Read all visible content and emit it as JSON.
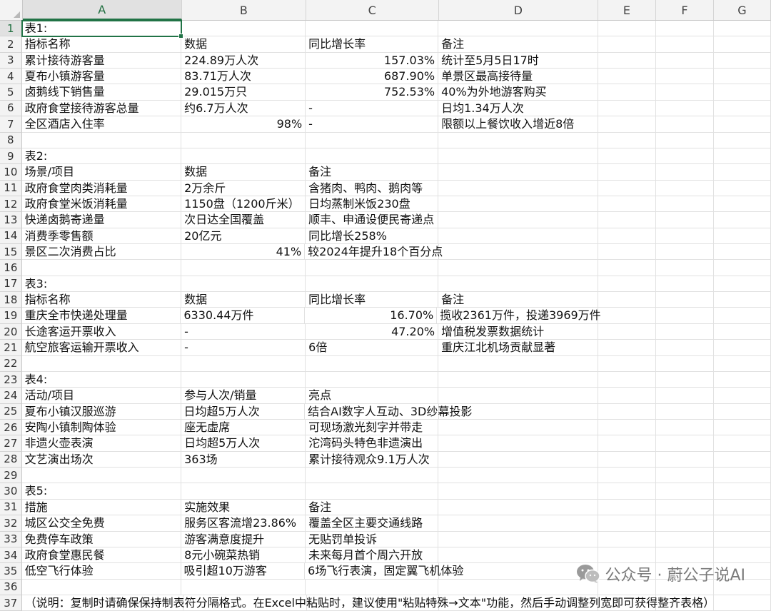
{
  "columns": [
    "A",
    "B",
    "C",
    "D",
    "E",
    "F",
    "G"
  ],
  "rows": [
    {
      "n": "1",
      "a": "表1:",
      "b": "",
      "c": "",
      "d": ""
    },
    {
      "n": "2",
      "a": "指标名称",
      "b": "数据",
      "c": "同比增长率",
      "d": "备注"
    },
    {
      "n": "3",
      "a": "累计接待游客量",
      "b": "224.89万人次",
      "c": "157.03%",
      "d": "统计至5月5日17时",
      "c_r": true
    },
    {
      "n": "4",
      "a": "夏布小镇游客量",
      "b": "83.71万人次",
      "c": "687.90%",
      "d": "单景区最高接待量",
      "c_r": true
    },
    {
      "n": "5",
      "a": "卤鹅线下销售量",
      "b": "29.015万只",
      "c": "752.53%",
      "d": "40%为外地游客购买",
      "c_r": true
    },
    {
      "n": "6",
      "a": "政府食堂接待游客总量",
      "b": "约6.7万人次",
      "c": "-",
      "d": "日均1.34万人次"
    },
    {
      "n": "7",
      "a": "全区酒店入住率",
      "b": "98%",
      "c": "-",
      "d": "限额以上餐饮收入增近8倍",
      "b_r": true
    },
    {
      "n": "8",
      "a": "",
      "b": "",
      "c": "",
      "d": ""
    },
    {
      "n": "9",
      "a": "表2:",
      "b": "",
      "c": "",
      "d": ""
    },
    {
      "n": "10",
      "a": "场景/项目",
      "b": "数据",
      "c": "备注",
      "d": ""
    },
    {
      "n": "11",
      "a": "政府食堂肉类消耗量",
      "b": "2万余斤",
      "c": "含猪肉、鸭肉、鹅肉等",
      "d": ""
    },
    {
      "n": "12",
      "a": "政府食堂米饭消耗量",
      "b": "1150盘（1200斤米）",
      "c": "日均蒸制米饭230盘",
      "d": ""
    },
    {
      "n": "13",
      "a": "快递卤鹅寄递量",
      "b": "次日达全国覆盖",
      "c": "顺丰、申通设便民寄递点",
      "d": ""
    },
    {
      "n": "14",
      "a": "消费季零售额",
      "b": "20亿元",
      "c": "同比增长258%",
      "d": ""
    },
    {
      "n": "15",
      "a": "景区二次消费占比",
      "b": "41%",
      "c": "较2024年提升18个百分点",
      "d": "",
      "b_r": true
    },
    {
      "n": "16",
      "a": "",
      "b": "",
      "c": "",
      "d": ""
    },
    {
      "n": "17",
      "a": "表3:",
      "b": "",
      "c": "",
      "d": ""
    },
    {
      "n": "18",
      "a": "指标名称",
      "b": "数据",
      "c": "同比增长率",
      "d": "备注"
    },
    {
      "n": "19",
      "a": "重庆全市快递处理量",
      "b": "6330.44万件",
      "c": "16.70%",
      "d": "揽收2361万件，投递3969万件",
      "c_r": true
    },
    {
      "n": "20",
      "a": "长途客运开票收入",
      "b": "-",
      "c": "47.20%",
      "d": "增值税发票数据统计",
      "c_r": true
    },
    {
      "n": "21",
      "a": "航空旅客运输开票收入",
      "b": "-",
      "c": "6倍",
      "d": "重庆江北机场贡献显著"
    },
    {
      "n": "22",
      "a": "",
      "b": "",
      "c": "",
      "d": ""
    },
    {
      "n": "23",
      "a": "表4:",
      "b": "",
      "c": "",
      "d": ""
    },
    {
      "n": "24",
      "a": "活动/项目",
      "b": "参与人次/销量",
      "c": "亮点",
      "d": ""
    },
    {
      "n": "25",
      "a": "夏布小镇汉服巡游",
      "b": "日均超5万人次",
      "c": "结合AI数字人互动、3D纱幕投影",
      "d": ""
    },
    {
      "n": "26",
      "a": "安陶小镇制陶体验",
      "b": "座无虚席",
      "c": "可现场激光刻字并带走",
      "d": ""
    },
    {
      "n": "27",
      "a": "非遗火壶表演",
      "b": "日均超5万人次",
      "c": "沱湾码头特色非遗演出",
      "d": ""
    },
    {
      "n": "28",
      "a": "文艺演出场次",
      "b": "363场",
      "c": "累计接待观众9.1万人次",
      "d": ""
    },
    {
      "n": "29",
      "a": "",
      "b": "",
      "c": "",
      "d": ""
    },
    {
      "n": "30",
      "a": "表5:",
      "b": "",
      "c": "",
      "d": ""
    },
    {
      "n": "31",
      "a": "措施",
      "b": "实施效果",
      "c": "备注",
      "d": ""
    },
    {
      "n": "32",
      "a": "城区公交全免费",
      "b": "服务区客流增23.86%",
      "c": "覆盖全区主要交通线路",
      "d": ""
    },
    {
      "n": "33",
      "a": "免费停车政策",
      "b": "游客满意度提升",
      "c": "无贴罚单投诉",
      "d": ""
    },
    {
      "n": "34",
      "a": "政府食堂惠民餐",
      "b": "8元小碗菜热销",
      "c": "未来每月首个周六开放",
      "d": ""
    },
    {
      "n": "35",
      "a": "低空飞行体验",
      "b": "吸引超10万游客",
      "c": "6场飞行表演，固定翼飞机体验",
      "d": ""
    },
    {
      "n": "36",
      "a": "",
      "b": "",
      "c": "",
      "d": ""
    },
    {
      "n": "37",
      "a": "（说明：复制时请确保保持制表符分隔格式。在Excel中粘贴时，建议使用\"粘贴特殊→文本\"功能，然后手动调整列宽即可获得整齐表格）",
      "b": "",
      "c": "",
      "d": ""
    }
  ],
  "watermark": {
    "text": "公众号 · 蔚公子说AI",
    "icon": "wechat-icon"
  },
  "accent_color": "#217346"
}
